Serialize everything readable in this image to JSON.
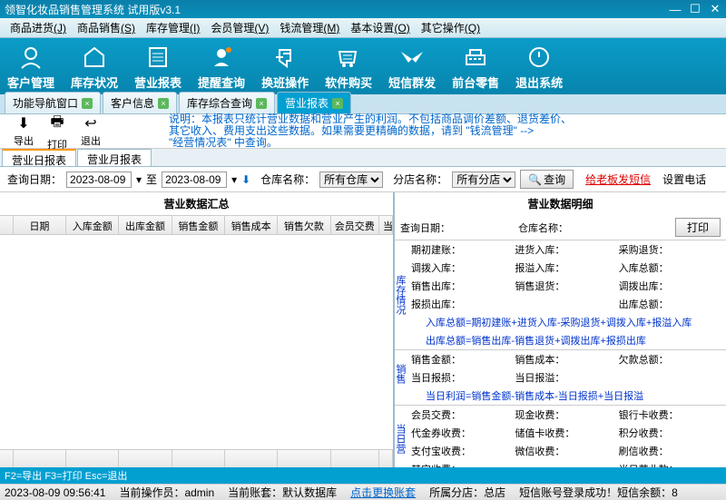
{
  "window": {
    "title": "领智化妆品销售管理系统 试用版v3.1"
  },
  "menu": [
    {
      "t": "商品进货",
      "k": "(J)"
    },
    {
      "t": "商品销售",
      "k": "(S)"
    },
    {
      "t": "库存管理",
      "k": "(I)"
    },
    {
      "t": "会员管理",
      "k": "(V)"
    },
    {
      "t": "钱流管理",
      "k": "(M)"
    },
    {
      "t": "基本设置",
      "k": "(O)"
    },
    {
      "t": "其它操作",
      "k": "(Q)"
    }
  ],
  "toolbar": [
    {
      "l": "客户管理"
    },
    {
      "l": "库存状况"
    },
    {
      "l": "营业报表"
    },
    {
      "l": "提醒查询"
    },
    {
      "l": "换班操作"
    },
    {
      "l": "软件购买"
    },
    {
      "l": "短信群发"
    },
    {
      "l": "前台零售"
    },
    {
      "l": "退出系统"
    }
  ],
  "tabs": [
    {
      "l": "功能导航窗口"
    },
    {
      "l": "客户信息"
    },
    {
      "l": "库存综合查询"
    },
    {
      "l": "营业报表",
      "active": true
    }
  ],
  "actions": {
    "export": "导出",
    "print": "打印",
    "exit": "退出"
  },
  "notice": {
    "l1": "说明：本报表只统计营业数据和营业产生的利润。不包括商品调价差额、退货差价、",
    "l2": "其它收入、费用支出这些数据。如果需要更精确的数据，请到 \"钱流管理\" -->",
    "l3": "\"经营情况表\" 中查询。"
  },
  "subtabs": [
    {
      "l": "营业日报表",
      "active": true
    },
    {
      "l": "营业月报表"
    }
  ],
  "filter": {
    "dateLbl": "查询日期：",
    "date1": "2023-08-09",
    "to": "至",
    "date2": "2023-08-09",
    "whLbl": "仓库名称：",
    "wh": "所有仓库",
    "storeLbl": "分店名称：",
    "store": "所有分店",
    "query": "查询",
    "sms": "给老板发短信",
    "phone": "设置电话"
  },
  "left": {
    "title": "营业数据汇总",
    "cols": [
      "日期",
      "入库金额",
      "出库金额",
      "销售金额",
      "销售成本",
      "销售欠款",
      "会员交费",
      "当"
    ]
  },
  "right": {
    "title": "营业数据明细",
    "r1": {
      "a": "查询日期：",
      "b": "仓库名称：",
      "btn": "打印"
    },
    "sec1": {
      "label": "库存情况",
      "rows": [
        [
          "期初建账：",
          "进货入库：",
          "采购退货："
        ],
        [
          "调拨入库：",
          "报溢入库：",
          "入库总额："
        ],
        [
          "销售出库：",
          "销售退货：",
          "调拨出库："
        ],
        [
          "报损出库：",
          "",
          "出库总额："
        ]
      ],
      "f1": "入库总额=期初建账+进货入库-采购退货+调拨入库+报溢入库",
      "f2": "出库总额=销售出库-销售退货+调拨出库+报损出库"
    },
    "sec2": {
      "label": "销售及利润",
      "rows": [
        [
          "销售金额：",
          "销售成本：",
          "欠款总额："
        ],
        [
          "当日报损：",
          "当日报溢：",
          ""
        ]
      ],
      "f": "当日利润=销售金额-销售成本-当日报损+当日报溢"
    },
    "sec3": {
      "label": "当日营业款",
      "rows": [
        [
          "会员交费：",
          "现金收费：",
          "银行卡收费："
        ],
        [
          "代金券收费：",
          "储值卡收费：",
          "积分收费："
        ],
        [
          "支付宝收费：",
          "微信收费：",
          "刷信收费："
        ],
        [
          "其它收费：",
          "",
          "当日营业款："
        ]
      ]
    }
  },
  "status1": "F2=导出 F3=打印 Esc=退出",
  "status2": {
    "time": "2023-08-09 09:56:41",
    "user": "当前操作员：admin",
    "db": "当前账套：默认数据库",
    "link": "点击更换账套",
    "store": "所属分店：总店",
    "sms": "短信账号登录成功！短信余额：8"
  }
}
